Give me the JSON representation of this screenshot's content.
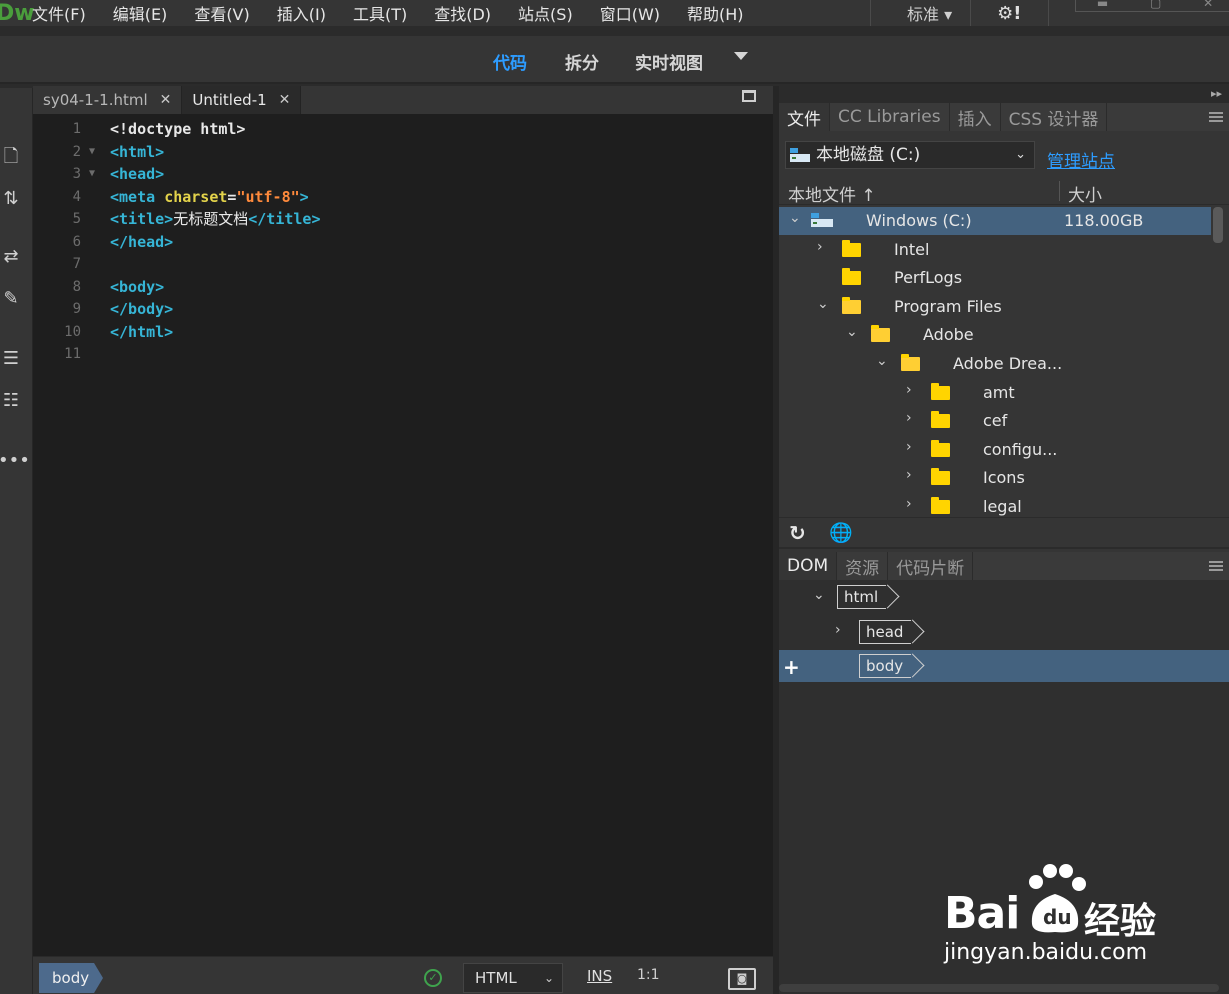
{
  "app": {
    "logo": "Dw"
  },
  "menu": [
    "文件(F)",
    "编辑(E)",
    "查看(V)",
    "插入(I)",
    "工具(T)",
    "查找(D)",
    "站点(S)",
    "窗口(W)",
    "帮助(H)"
  ],
  "workspace": {
    "label": "标准",
    "caret": "▾"
  },
  "views": {
    "code": "代码",
    "split": "拆分",
    "live": "实时视图"
  },
  "tabs": [
    {
      "label": "sy04-1-1.html",
      "active": false
    },
    {
      "label": "Untitled-1",
      "active": true
    }
  ],
  "editor": {
    "lines": [
      {
        "n": "1",
        "fold": "",
        "tokens": [
          {
            "t": "<!doctype html>",
            "c": "c-plain"
          }
        ]
      },
      {
        "n": "2",
        "fold": "▼",
        "tokens": [
          {
            "t": "<html>",
            "c": "c-tag"
          }
        ]
      },
      {
        "n": "3",
        "fold": "▼",
        "tokens": [
          {
            "t": "<head>",
            "c": "c-tag"
          }
        ]
      },
      {
        "n": "4",
        "fold": "",
        "tokens": [
          {
            "t": "<meta ",
            "c": "c-tag"
          },
          {
            "t": "charset",
            "c": "c-attr"
          },
          {
            "t": "=",
            "c": "c-plain"
          },
          {
            "t": "\"utf-8\"",
            "c": "c-str"
          },
          {
            "t": ">",
            "c": "c-tag"
          }
        ]
      },
      {
        "n": "5",
        "fold": "",
        "tokens": [
          {
            "t": "<title>",
            "c": "c-tag"
          },
          {
            "t": "无标题文档",
            "c": "c-text"
          },
          {
            "t": "</title>",
            "c": "c-tag"
          }
        ]
      },
      {
        "n": "6",
        "fold": "",
        "tokens": [
          {
            "t": "</head>",
            "c": "c-tag"
          }
        ]
      },
      {
        "n": "7",
        "fold": "",
        "tokens": []
      },
      {
        "n": "8",
        "fold": "",
        "tokens": [
          {
            "t": "<body>",
            "c": "c-tag"
          }
        ]
      },
      {
        "n": "9",
        "fold": "",
        "tokens": [
          {
            "t": "</body>",
            "c": "c-tag"
          }
        ]
      },
      {
        "n": "10",
        "fold": "",
        "tokens": [
          {
            "t": "</html>",
            "c": "c-tag"
          }
        ]
      },
      {
        "n": "11",
        "fold": "",
        "tokens": []
      }
    ]
  },
  "status": {
    "tag": "body",
    "language": "HTML",
    "mode": "INS",
    "position": "1:1"
  },
  "files_panel": {
    "tabs": [
      "文件",
      "CC Libraries",
      "插入",
      "CSS 设计器"
    ],
    "site": "本地磁盘 (C:)",
    "manage": "管理站点",
    "col_local": "本地文件 ↑",
    "col_size": "大小",
    "tree": [
      {
        "label": "Windows (C:)",
        "size": "118.00GB",
        "depth": 0,
        "arrow": "⌄",
        "icon": "drive",
        "selected": true
      },
      {
        "label": "Intel",
        "size": "",
        "depth": 1,
        "arrow": "›",
        "icon": "folder"
      },
      {
        "label": "PerfLogs",
        "size": "",
        "depth": 1,
        "arrow": "",
        "icon": "folder"
      },
      {
        "label": "Program Files",
        "size": "",
        "depth": 1,
        "arrow": "⌄",
        "icon": "folder-open"
      },
      {
        "label": "Adobe",
        "size": "",
        "depth": 2,
        "arrow": "⌄",
        "icon": "folder-open"
      },
      {
        "label": "Adobe Drea...",
        "size": "",
        "depth": 3,
        "arrow": "⌄",
        "icon": "folder-open"
      },
      {
        "label": "amt",
        "size": "",
        "depth": 4,
        "arrow": "›",
        "icon": "folder"
      },
      {
        "label": "cef",
        "size": "",
        "depth": 4,
        "arrow": "›",
        "icon": "folder"
      },
      {
        "label": "configu...",
        "size": "",
        "depth": 4,
        "arrow": "›",
        "icon": "folder"
      },
      {
        "label": "Icons",
        "size": "",
        "depth": 4,
        "arrow": "›",
        "icon": "folder"
      },
      {
        "label": "legal",
        "size": "",
        "depth": 4,
        "arrow": "›",
        "icon": "folder"
      }
    ]
  },
  "dom_panel": {
    "tabs": [
      "DOM",
      "资源",
      "代码片断"
    ],
    "nodes": [
      {
        "tag": "html",
        "arrow": "⌄",
        "depth": 0
      },
      {
        "tag": "head",
        "arrow": "›",
        "depth": 1
      },
      {
        "tag": "body",
        "arrow": "",
        "depth": 1,
        "selected": true
      }
    ],
    "add": "+"
  },
  "watermark": {
    "brand": "Bai",
    "brand2": "经验",
    "url": "jingyan.baidu.com"
  },
  "colors": {
    "accent": "#2d9cff",
    "selection": "#44627f",
    "logo": "#4a9e3c",
    "folder": "#ffd400"
  }
}
